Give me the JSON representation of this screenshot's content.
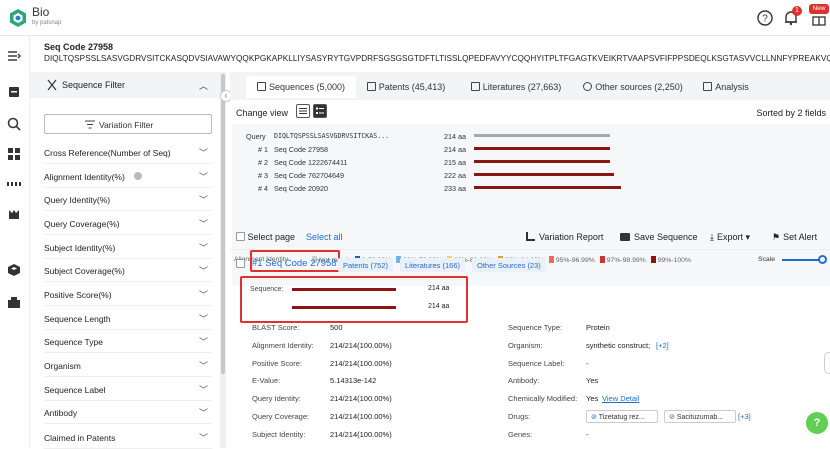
{
  "app": {
    "name": "Bio",
    "by": "by patsnap",
    "new_badge": "New",
    "notif_count": "1"
  },
  "sequence": {
    "code": "Seq Code 27958",
    "string": "DIQLTQSPSSLSASVGDRVSITCKASQDVSIAVAWYQQKPGKAPKLLIYSASYRYTGVPDRFSGSGSGTDFTLTISSLQPEDFAVYYCQQHYITPLTFGAGTKVEIKRTVAAPSVFIFPPSDEQLKSGTASVVCLLNNFYPREAKVQWKVDNALQSGNSQESVTEQDSKDSTYSLSSTLTLSKADYEKHKVYACEVTHQGLSSPVTKSFNRGEC"
  },
  "filter": {
    "title": "Sequence Filter",
    "variation_button": "Variation Filter",
    "items": [
      "Cross Reference(Number of Seq)",
      "Alignment Identity(%)",
      "Query Identity(%)",
      "Query Coverage(%)",
      "Subject Identity(%)",
      "Subject Coverage(%)",
      "Positive Score(%)",
      "Sequence Length",
      "Sequence Type",
      "Organism",
      "Sequence Label",
      "Antibody",
      "Claimed in Patents"
    ]
  },
  "tabs": [
    {
      "label": "Sequences (5,000)",
      "icon": "dna-icon"
    },
    {
      "label": "Patents (45,413)",
      "icon": "patent-icon"
    },
    {
      "label": "Literatures (27,663)",
      "icon": "book-icon"
    },
    {
      "label": "Other sources (2,250)",
      "icon": "cube-icon"
    },
    {
      "label": "Analysis",
      "icon": "bar-chart-icon"
    }
  ],
  "view": {
    "change_view": "Change view",
    "sorted_by": "Sorted by 2 fields"
  },
  "alignment": {
    "query_label": "Query",
    "query_seq": "DIQLTQSPSSLSASVGDRVSITCKAS...",
    "query_len": "214 aa",
    "query_frac": 1.0,
    "rows": [
      {
        "num": "# 1",
        "code": "Seq Code 27958",
        "len": "214 aa",
        "frac": 1.0
      },
      {
        "num": "# 2",
        "code": "Seq Code 1222674411",
        "len": "215 aa",
        "frac": 1.0
      },
      {
        "num": "# 3",
        "code": "Seq Code 762704649",
        "len": "222 aa",
        "frac": 1.03
      },
      {
        "num": "# 4",
        "code": "Seq Code 20920",
        "len": "233 aa",
        "frac": 1.08
      }
    ],
    "legend_title": "Alignment Identity",
    "legend": [
      {
        "label": "Not match",
        "color": "#d0d0d0"
      },
      {
        "label": "0-59.99%",
        "color": "#1d5fb4"
      },
      {
        "label": "60%-79.99%",
        "color": "#73b2e8"
      },
      {
        "label": "80%-89.99%",
        "color": "#f3d36a"
      },
      {
        "label": "90%-94.99%",
        "color": "#f0952f"
      },
      {
        "label": "95%-96.99%",
        "color": "#e86a6a"
      },
      {
        "label": "97%-98.99%",
        "color": "#cf3333"
      },
      {
        "label": "99%-100%",
        "color": "#8b1414"
      }
    ],
    "scale_label": "Scale"
  },
  "toolbar": {
    "select_page": "Select page",
    "select_all": "Select all",
    "variation_report": "Variation Report",
    "save_sequence": "Save Sequence",
    "export": "Export",
    "set_alert": "Set Alert"
  },
  "result": {
    "title": "#1 Seq Code 27958",
    "chips": [
      "Patents (752)",
      "Literatures (166)",
      "Other Sources (23)"
    ],
    "sequence_label": "Sequence:",
    "seq_lens": [
      "214 aa",
      "214 aa"
    ],
    "left": [
      {
        "k": "BLAST Score:",
        "v": "500"
      },
      {
        "k": "Alignment Identity:",
        "v": "214/214(100.00%)"
      },
      {
        "k": "Positive Score:",
        "v": "214/214(100.00%)"
      },
      {
        "k": "E-Value:",
        "v": "5.14313e-142"
      },
      {
        "k": "Query Identity:",
        "v": "214/214(100.00%)"
      },
      {
        "k": "Query Coverage:",
        "v": "214/214(100.00%)"
      },
      {
        "k": "Subject Identity:",
        "v": "214/214(100.00%)"
      }
    ],
    "right": [
      {
        "k": "Sequence Type:",
        "v": "Protein"
      },
      {
        "k": "Organism:",
        "v": "synthetic construct;",
        "extra": "[+2]"
      },
      {
        "k": "Sequence Label:",
        "v": "-"
      },
      {
        "k": "Antibody:",
        "v": "Yes"
      },
      {
        "k": "Chemically Modified:",
        "v": "Yes",
        "extra": "View Detail"
      },
      {
        "k": "Drugs:",
        "v": ""
      },
      {
        "k": "Genes:",
        "v": "-"
      }
    ],
    "drugs": [
      "Tizetatug rez...",
      "Sacituzumab..."
    ],
    "drugs_more": "[+3]"
  }
}
